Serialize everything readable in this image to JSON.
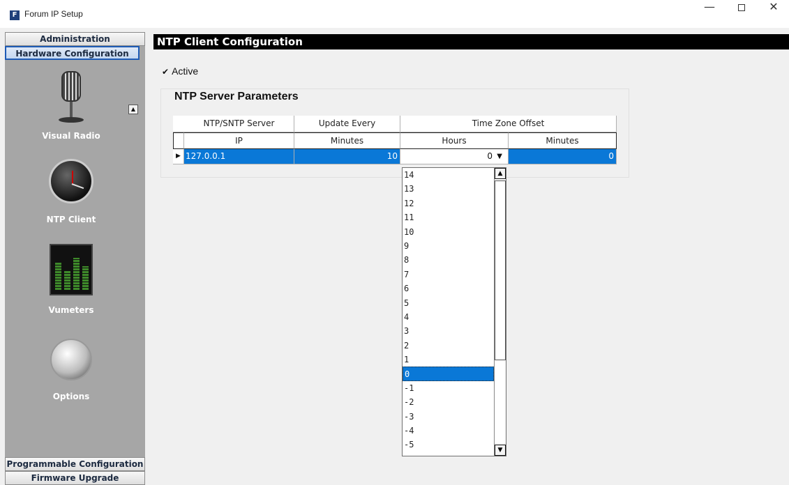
{
  "window": {
    "title": "Forum IP Setup",
    "icon_letter": "F",
    "minimize": "—",
    "close": "✕"
  },
  "sidebar": {
    "top_headers": [
      "Administration",
      "Hardware Configuration"
    ],
    "items": [
      {
        "label": "Visual Radio",
        "icon": "microphone-icon"
      },
      {
        "label": "NTP Client",
        "icon": "clock-icon"
      },
      {
        "label": "Vumeters",
        "icon": "vumeter-icon"
      },
      {
        "label": "Options",
        "icon": "gear-icon"
      }
    ],
    "bottom_headers": [
      "Programmable Configuration",
      "Firmware Upgrade"
    ],
    "scroll_up": "▲"
  },
  "main": {
    "header": "NTP Client Configuration",
    "active_label": "Active",
    "active_checked": true,
    "group_title": "NTP Server Parameters",
    "table": {
      "group_headers": [
        "NTP/SNTP Server",
        "Update Every",
        "Time Zone Offset"
      ],
      "column_headers": [
        "IP",
        "Minutes",
        "Hours",
        "Minutes"
      ],
      "row": {
        "indicator": "▶",
        "ip": "127.0.0.1",
        "update_minutes": "10",
        "tz_hours": "0",
        "tz_minutes": "0"
      }
    },
    "dropdown": {
      "options": [
        "14",
        "13",
        "12",
        "11",
        "10",
        "9",
        "8",
        "7",
        "6",
        "5",
        "4",
        "3",
        "2",
        "1",
        "0",
        "-1",
        "-2",
        "-3",
        "-4",
        "-5"
      ],
      "selected": "0"
    }
  },
  "colors": {
    "selection": "#0a78d7",
    "sidebar_bg": "#a6a6a6",
    "header_bg": "#000000"
  }
}
